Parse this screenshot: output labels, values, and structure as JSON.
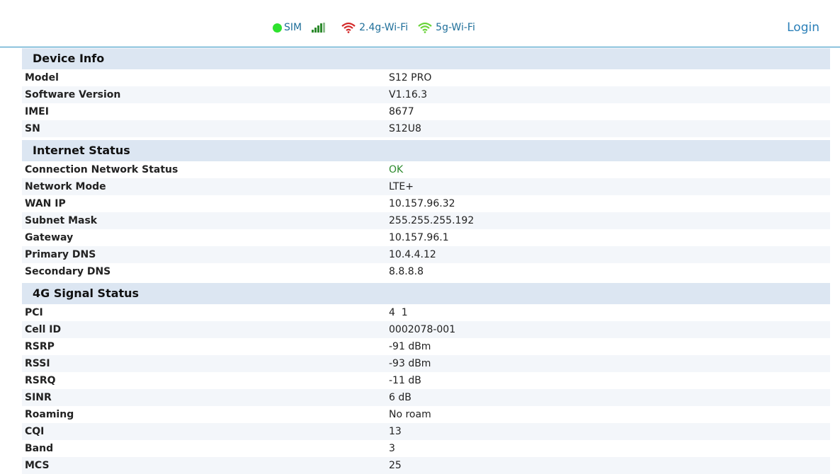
{
  "header": {
    "sim_label": "SIM",
    "wifi24_label": "2.4g-Wi-Fi",
    "wifi5_label": "5g-Wi-Fi",
    "login_label": "Login",
    "colors": {
      "sim_dot": "#2ee22e",
      "wifi24": "#d42a2a",
      "wifi5": "#6ad43a",
      "signal": "#2d8a2d"
    }
  },
  "sections": {
    "device": {
      "title": "Device Info",
      "rows": [
        {
          "label": "Model",
          "value": "S12 PRO"
        },
        {
          "label": "Software Version",
          "value": "V1.16.3"
        },
        {
          "label": "IMEI",
          "value": "8677"
        },
        {
          "label": "SN",
          "value": "S12U8"
        }
      ]
    },
    "internet": {
      "title": "Internet Status",
      "rows": [
        {
          "label": "Connection Network Status",
          "value": "OK"
        },
        {
          "label": "Network Mode",
          "value": "LTE+"
        },
        {
          "label": "WAN IP",
          "value": "10.157.96.32"
        },
        {
          "label": "Subnet Mask",
          "value": "255.255.255.192"
        },
        {
          "label": "Gateway",
          "value": "10.157.96.1"
        },
        {
          "label": "Primary DNS",
          "value": "10.4.4.12"
        },
        {
          "label": "Secondary DNS",
          "value": "8.8.8.8"
        }
      ]
    },
    "signal": {
      "title": "4G Signal Status",
      "rows": [
        {
          "label": "PCI",
          "value": "4  1"
        },
        {
          "label": "Cell ID",
          "value": "0002078-001"
        },
        {
          "label": "RSRP",
          "value": "-91 dBm"
        },
        {
          "label": "RSSI",
          "value": "-93 dBm"
        },
        {
          "label": "RSRQ",
          "value": "-11 dB"
        },
        {
          "label": "SINR",
          "value": "6 dB"
        },
        {
          "label": "Roaming",
          "value": "No roam"
        },
        {
          "label": "CQI",
          "value": "13"
        },
        {
          "label": "Band",
          "value": "3"
        },
        {
          "label": "MCS",
          "value": "25"
        }
      ]
    }
  }
}
